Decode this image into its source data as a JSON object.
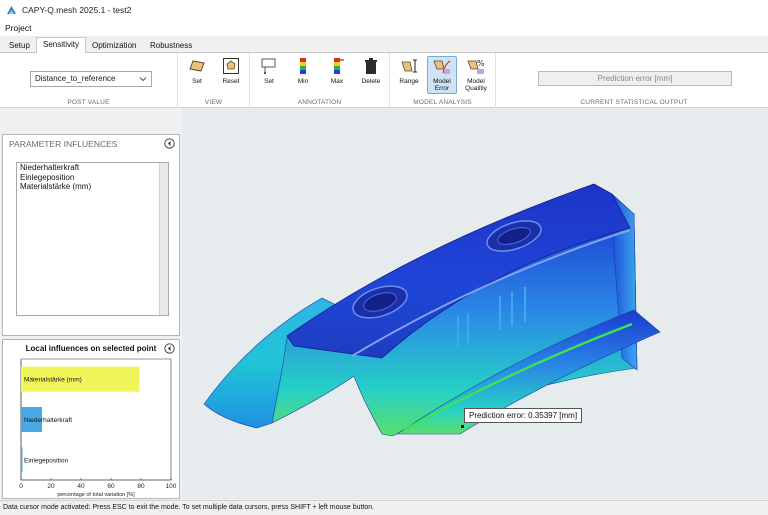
{
  "window": {
    "title": "CAPY-Q.mesh 2025.1 - test2"
  },
  "menu": {
    "items": [
      "Project"
    ]
  },
  "tabs": [
    "Setup",
    "Sensitivity",
    "Optimization",
    "Robustness"
  ],
  "ribbon": {
    "post_value": {
      "selected": "Distance_to_reference",
      "group_label": "POST VALUE"
    },
    "view": {
      "buttons": [
        "Set",
        "Reset"
      ],
      "group_label": "VIEW"
    },
    "annotation": {
      "buttons": [
        "Set",
        "Min",
        "Max",
        "Delete"
      ],
      "group_label": "ANNOTATION"
    },
    "model_analysis": {
      "buttons": [
        "Range",
        "Model\nError",
        "Model\nQualitiy"
      ],
      "btn_range": "Range",
      "btn_error_1": "Model",
      "btn_error_2": "Error",
      "btn_quality_1": "Model",
      "btn_quality_2": "Qualitiy",
      "group_label": "MODEL ANALYSIS"
    },
    "statistical_output": {
      "value": "Prediction error [mm]",
      "group_label": "CURRENT STATISTICAL OUTPUT"
    }
  },
  "parameter_panel": {
    "title": "PARAMETER INFLUENCES",
    "items": [
      "Niederhalterkraft",
      "Einlegeposition",
      "Materialstärke (mm)"
    ]
  },
  "local_panel": {
    "title": "Local influences on selected point"
  },
  "chart_data": {
    "type": "bar",
    "orientation": "horizontal",
    "title": "Local influences on selected point",
    "categories": [
      "Materialstärke (mm)",
      "Niederhalterkraft",
      "Einlegeposition"
    ],
    "values": [
      79,
      14,
      1
    ],
    "colors": [
      "#f0f55a",
      "#4aa9e2",
      "#4aa9e2"
    ],
    "xlabel": "percentage of total variation [%]",
    "xlim": [
      0,
      100
    ],
    "xticks": [
      0,
      20,
      40,
      60,
      80,
      100
    ]
  },
  "viewport": {
    "tooltip": "Prediction error: 0.35397 [mm]"
  },
  "status": {
    "text": "Data cursor mode activated: Press ESC to exit the mode. To set multiple data cursors, press SHIFT + left mouse button."
  },
  "colors": {
    "accent": "#0063b1",
    "selected_button": "#cfe3f7",
    "bar_major": "#f0f55a",
    "bar_minor": "#4aa9e2"
  }
}
